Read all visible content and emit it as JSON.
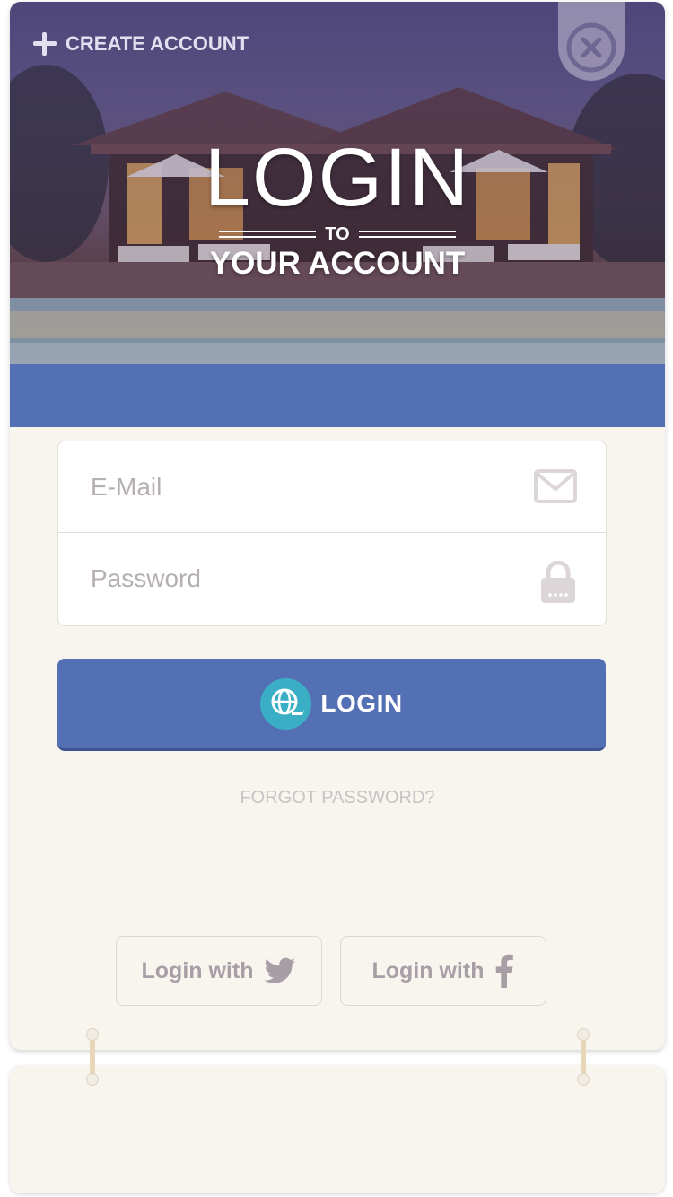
{
  "header": {
    "create_account_label": "CREATE ACCOUNT",
    "title_main": "LOGIN",
    "title_to": "TO",
    "title_sub": "YOUR ACCOUNT"
  },
  "form": {
    "email_placeholder": "E-Mail",
    "password_placeholder": "Password",
    "login_label": "LOGIN",
    "forgot_label": "FORGOT PASSWORD?"
  },
  "social": {
    "twitter_label": "Login with",
    "facebook_label": "Login with"
  },
  "colors": {
    "accent_blue": "#5470b4",
    "globe_teal": "#3aaec5",
    "card_bg": "#f8f5ef",
    "muted_text": "#b5aeb3"
  },
  "icons": {
    "create": "plus-icon",
    "close": "close-icon",
    "email": "envelope-icon",
    "password": "lock-icon",
    "login": "globe-plane-icon",
    "twitter": "twitter-icon",
    "facebook": "facebook-icon"
  }
}
